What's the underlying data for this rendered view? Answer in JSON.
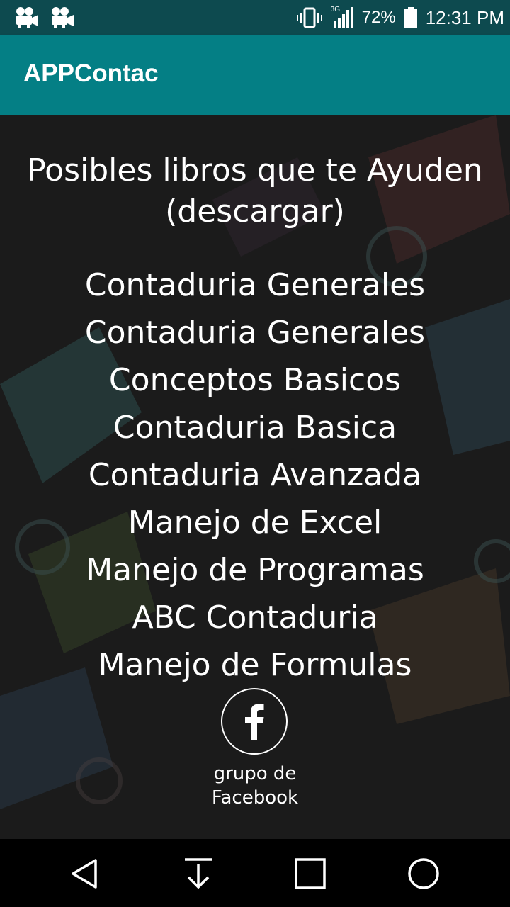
{
  "status_bar": {
    "signal_type": "3G",
    "battery": "72%",
    "time": "12:31 PM",
    "icons": [
      "video-camera-icon",
      "video-camera-icon",
      "vibrate-icon",
      "signal-icon",
      "battery-icon"
    ]
  },
  "app_bar": {
    "title": "APPContac"
  },
  "content": {
    "heading_line1": "Posibles libros que te Ayuden",
    "heading_line2": "(descargar)",
    "books": [
      "Contaduria Generales",
      "Contaduria Generales",
      "Conceptos Basicos",
      "Contaduria Basica",
      "Contaduria Avanzada",
      "Manejo de Excel",
      "Manejo de Programas",
      "ABC Contaduria",
      "Manejo de Formulas"
    ],
    "facebook": {
      "icon": "facebook-icon",
      "label_line1": "grupo de",
      "label_line2": "Facebook"
    }
  },
  "nav_bar": {
    "icons": [
      "back-icon",
      "download-icon",
      "recents-icon",
      "home-icon"
    ]
  },
  "colors": {
    "status_bar": "#0d4a4f",
    "app_bar": "#047f85",
    "background": "#1b1b1b",
    "text": "#ffffff"
  }
}
